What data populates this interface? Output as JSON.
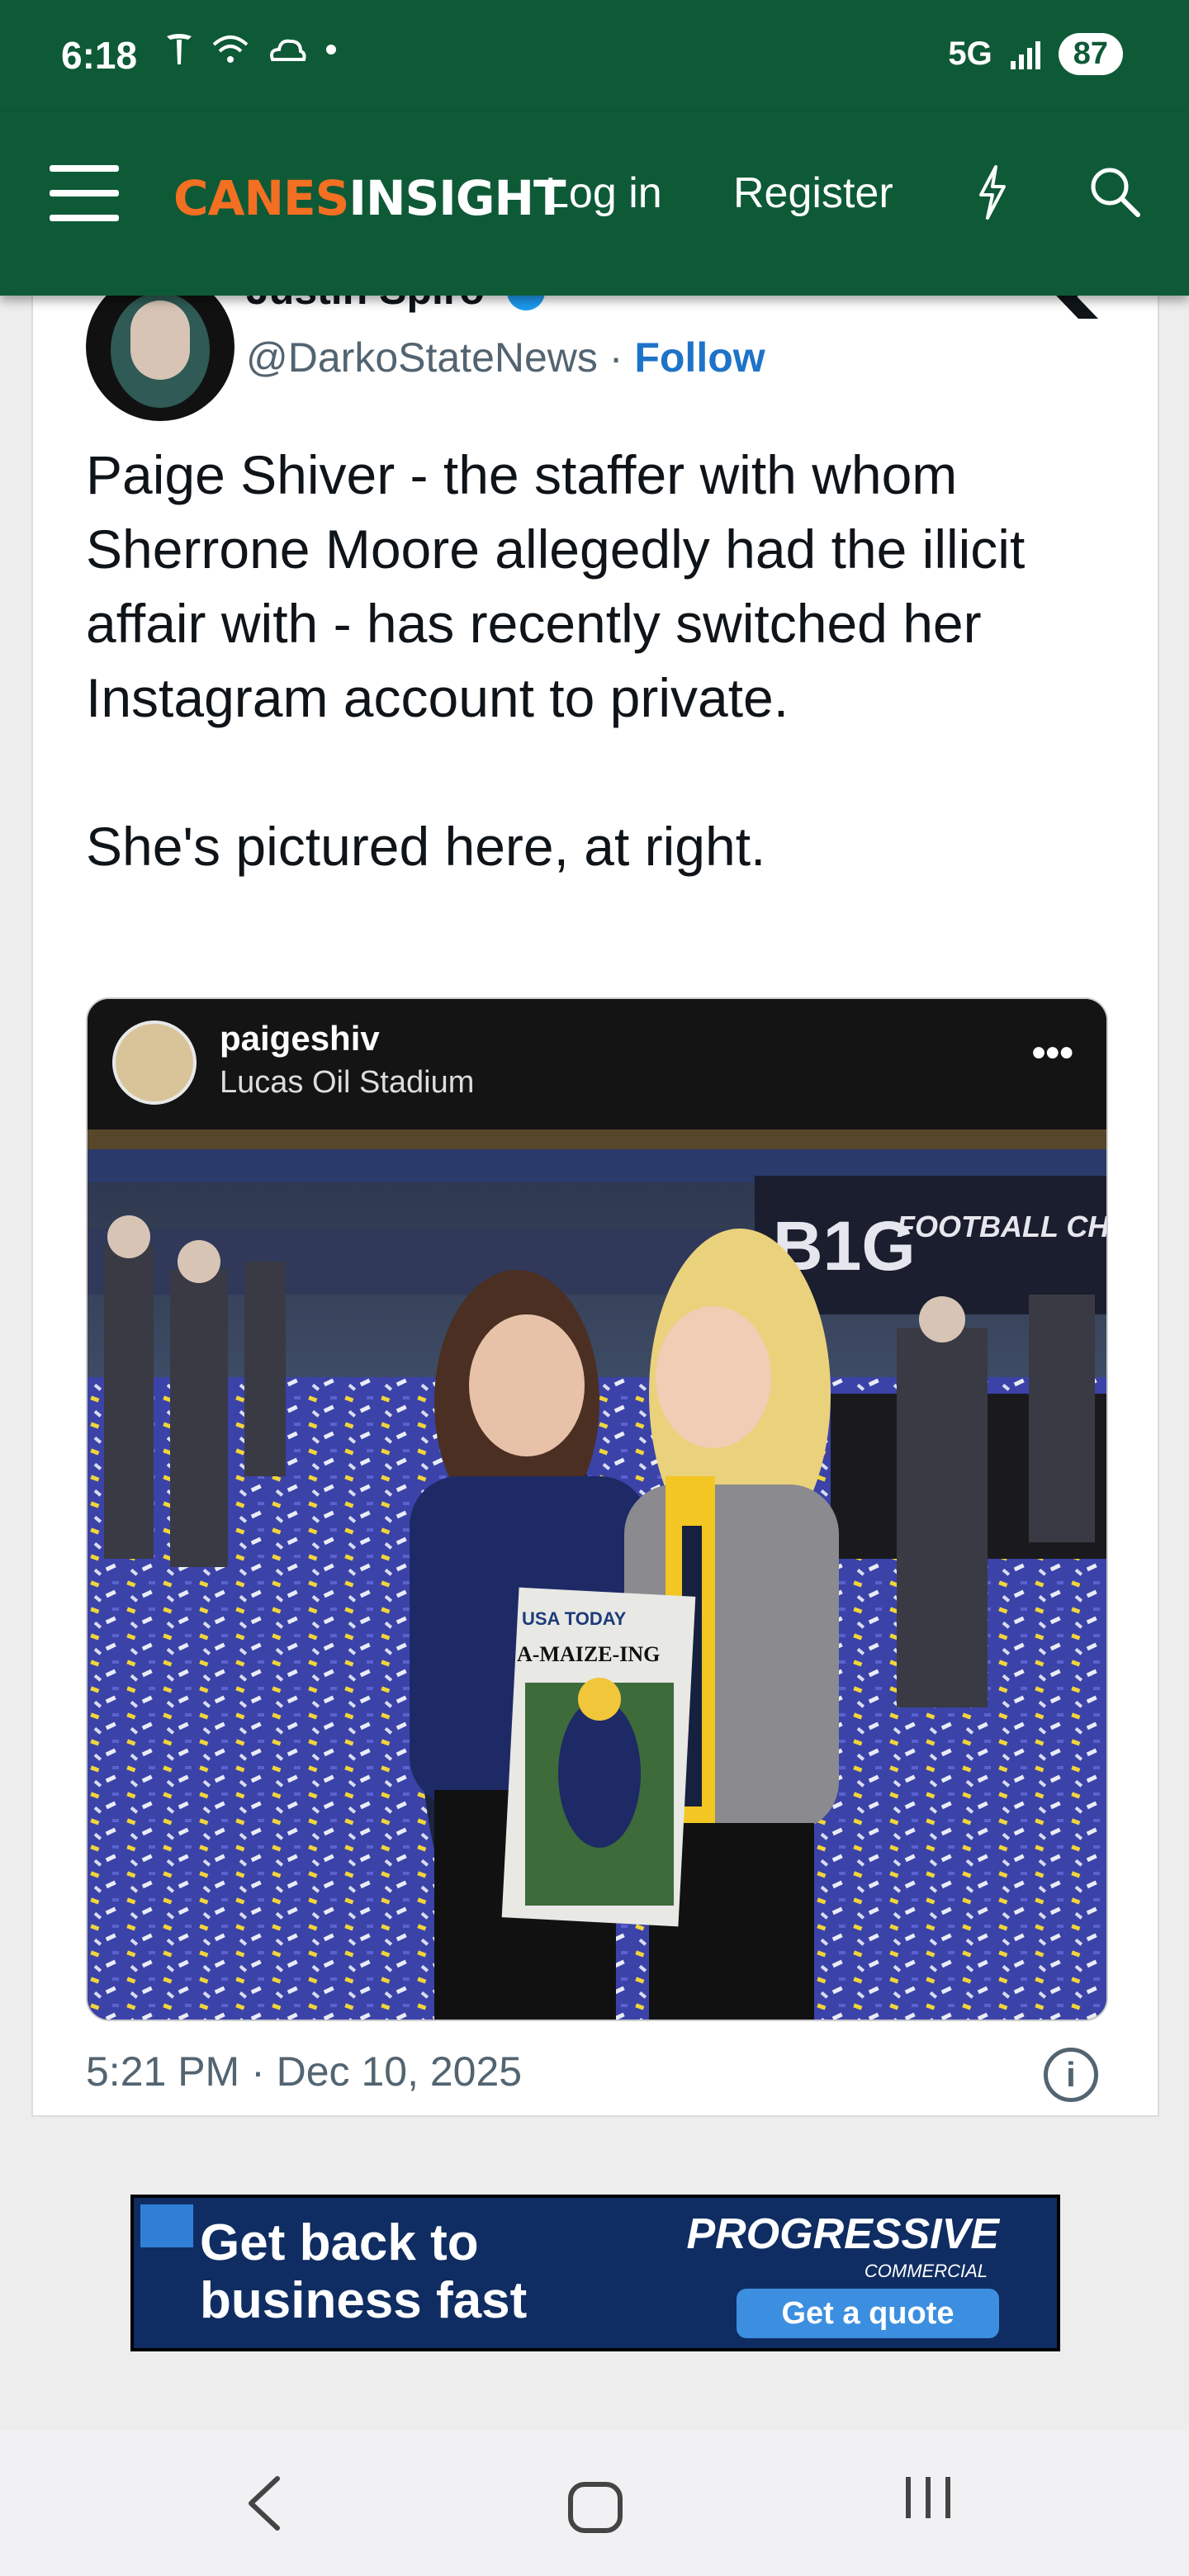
{
  "status_bar": {
    "time": "6:18",
    "network": "5G",
    "battery": "87"
  },
  "nav": {
    "logo_part1": "CANES",
    "logo_part2": "INSIGHT",
    "login": "Log in",
    "register": "Register"
  },
  "tweet": {
    "name": "Justin Spiro",
    "handle": "@DarkoStateNews",
    "separator": " · ",
    "follow": "Follow",
    "text_p1": "Paige Shiver - the staffer with whom Sherrone Moore allegedly had the illicit affair with - has recently switched her Instagram account to private.",
    "text_p2": "She's pictured here, at right.",
    "timestamp": "5:21 PM · Dec 10, 2025",
    "info": "i"
  },
  "instagram": {
    "username": "paigeshiv",
    "location": "Lucas Oil Stadium",
    "more": "•••",
    "sign_big": "B1G",
    "sign_text": "FOOTBALL CHAMPI",
    "paper_masthead": "USA TODAY",
    "paper_headline": "A-MAIZE-ING"
  },
  "ad": {
    "headline_line1": "Get back to",
    "headline_line2": "business fast",
    "brand": "PROGRESSIVE",
    "brand_sub": "COMMERCIAL",
    "cta": "Get a quote"
  },
  "colors": {
    "header_green": "#0e5a37",
    "logo_orange": "#f36f21",
    "link_blue": "#1d73c8",
    "ad_navy": "#0f2d62"
  }
}
